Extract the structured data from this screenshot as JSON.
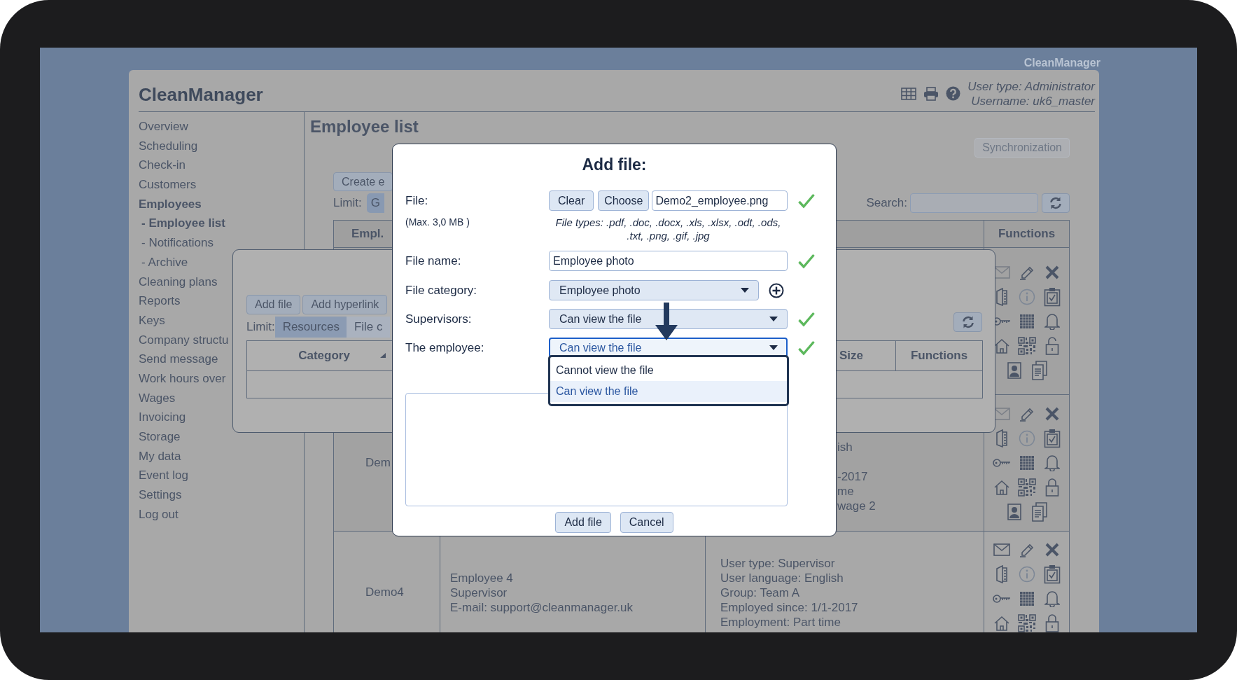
{
  "corner_brand": "CleanManager",
  "header": {
    "title": "CleanManager",
    "user_type": "User type: Administrator",
    "username": "Username: uk6_master"
  },
  "sidebar": {
    "items": [
      {
        "label": "Overview",
        "expanded": false
      },
      {
        "label": "Scheduling",
        "expanded": false
      },
      {
        "label": "Check-in",
        "expanded": false
      },
      {
        "label": "Customers",
        "expanded": false
      },
      {
        "label": "Employees",
        "expanded": true,
        "children": [
          {
            "label": "- Employee list",
            "selected": true
          },
          {
            "label": "- Notifications",
            "selected": false
          },
          {
            "label": "- Archive",
            "selected": false
          }
        ]
      },
      {
        "label": "Cleaning plans",
        "expanded": false
      },
      {
        "label": "Reports",
        "expanded": false
      },
      {
        "label": "Keys",
        "expanded": false
      },
      {
        "label": "Company structu",
        "expanded": false
      },
      {
        "label": "Send message",
        "expanded": false
      },
      {
        "label": "Work hours over",
        "expanded": false
      },
      {
        "label": "Wages",
        "expanded": false
      },
      {
        "label": "Invoicing",
        "expanded": false
      },
      {
        "label": "Storage",
        "expanded": false
      },
      {
        "label": "My data",
        "expanded": false
      },
      {
        "label": "Event log",
        "expanded": false
      },
      {
        "label": "Settings",
        "expanded": false
      },
      {
        "label": "Log out",
        "expanded": false
      }
    ]
  },
  "main": {
    "heading": "Employee list",
    "sync_button": {
      "label": "Synchronization",
      "disabled": true
    },
    "create_button": "Create e",
    "limit_label": "Limit:",
    "limit_segments": [
      {
        "label": "G",
        "selected": true
      }
    ],
    "search_label": "Search:",
    "table": {
      "columns": [
        "Empl.",
        "Functions"
      ],
      "rows": [
        {
          "kind": "covered",
          "mail_enabled": false,
          "locked": false
        },
        {
          "kind": "covered",
          "name": "Dem",
          "info_lines": [
            "ish",
            "-2017",
            "me",
            "wage 2"
          ],
          "mail_enabled": false,
          "locked": true
        },
        {
          "kind": "full",
          "name": "Demo4",
          "contact_lines": [
            "Employee 4",
            "Supervisor",
            "E-mail: support@cleanmanager.uk"
          ],
          "info_lines": [
            "User type: Supervisor",
            "User language: English",
            "Group: Team A",
            "Employed since: 1/1-2017",
            "Employment: Part time"
          ],
          "mail_enabled": true,
          "locked": true
        }
      ]
    }
  },
  "files_modal": {
    "buttons": [
      "Add file",
      "Add hyperlink"
    ],
    "limit_label": "Limit:",
    "segments": [
      {
        "label": "Resources",
        "selected": true
      },
      {
        "label": "File c",
        "selected": false
      }
    ],
    "columns": [
      "Category",
      "Size",
      "Functions"
    ]
  },
  "dialog": {
    "title": "Add file:",
    "file": {
      "label": "File:",
      "note": "(Max. 3,0 MB )",
      "clear": "Clear",
      "choose": "Choose",
      "value": "Demo2_employee.png",
      "valid": true,
      "types": "File types: .pdf, .doc, .docx, .xls, .xlsx, .odt, .ods, .txt, .png, .gif, .jpg"
    },
    "fields": [
      {
        "kind": "text",
        "label": "File name:",
        "value": "Employee photo",
        "valid": true,
        "focused": false
      },
      {
        "kind": "select",
        "label": "File category:",
        "value": "Employee photo",
        "valid": false,
        "addable": true,
        "focused": false
      },
      {
        "kind": "select",
        "label": "Supervisors:",
        "value": "Can view the file",
        "valid": true,
        "addable": false,
        "focused": false
      },
      {
        "kind": "select",
        "label": "The employee:",
        "value": "Can view the file",
        "valid": true,
        "addable": false,
        "focused": true,
        "options": [
          {
            "label": "Cannot view the file",
            "selected": false
          },
          {
            "label": "Can view the file",
            "selected": true
          }
        ]
      }
    ],
    "buttons": [
      "Add file",
      "Cancel"
    ]
  }
}
